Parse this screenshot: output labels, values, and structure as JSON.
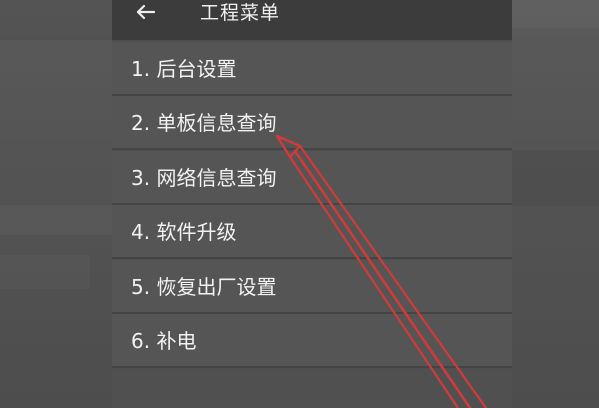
{
  "header": {
    "back_icon": "arrow-left-icon",
    "title": "工程菜单"
  },
  "menu": {
    "items": [
      {
        "label": "1. 后台设置"
      },
      {
        "label": "2. 单板信息查询"
      },
      {
        "label": "3. 网络信息查询"
      },
      {
        "label": "4. 软件升级"
      },
      {
        "label": "5. 恢复出厂设置"
      },
      {
        "label": "6. 补电"
      }
    ]
  },
  "annotation": {
    "color": "#d23a3a",
    "points_to": "2. 单板信息查询"
  }
}
